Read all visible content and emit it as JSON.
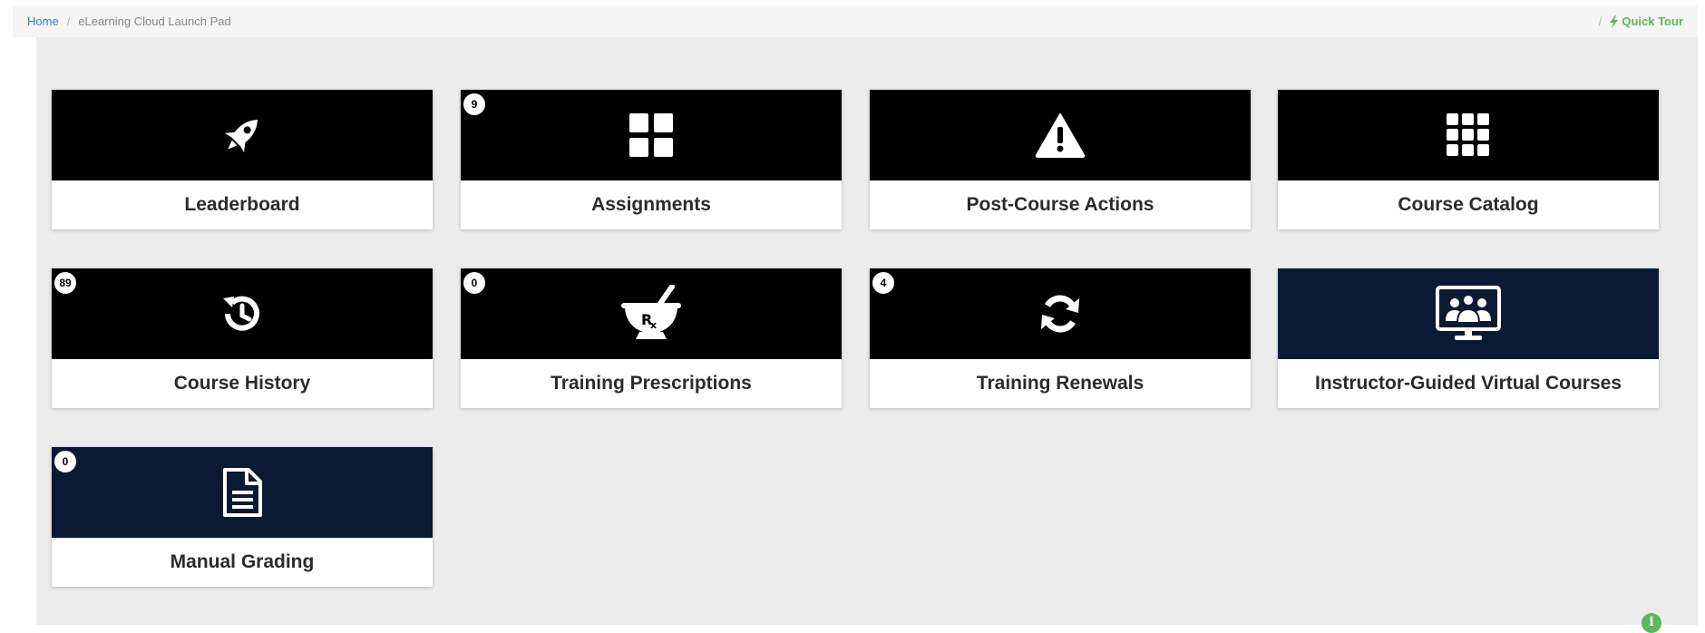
{
  "breadcrumb": {
    "home": "Home",
    "separator": "/",
    "current": "eLearning Cloud Launch Pad"
  },
  "quick_tour": {
    "separator": "/",
    "label": "Quick Tour",
    "icon": "bolt-icon"
  },
  "tiles": [
    {
      "label": "Leaderboard",
      "icon": "rocket-icon",
      "badge": null,
      "theme": "black"
    },
    {
      "label": "Assignments",
      "icon": "th-large-icon",
      "badge": "9",
      "theme": "black"
    },
    {
      "label": "Post-Course Actions",
      "icon": "warning-icon",
      "badge": null,
      "theme": "black"
    },
    {
      "label": "Course Catalog",
      "icon": "grid-icon",
      "badge": null,
      "theme": "black"
    },
    {
      "label": "Course History",
      "icon": "history-icon",
      "badge": "89",
      "theme": "black"
    },
    {
      "label": "Training Prescriptions",
      "icon": "mortar-pestle-rx-icon",
      "badge": "0",
      "theme": "black"
    },
    {
      "label": "Training Renewals",
      "icon": "refresh-icon",
      "badge": "4",
      "theme": "black"
    },
    {
      "label": "Instructor-Guided Virtual Courses",
      "icon": "virtual-class-icon",
      "badge": null,
      "theme": "navy"
    },
    {
      "label": "Manual Grading",
      "icon": "document-icon",
      "badge": "0",
      "theme": "navy"
    }
  ],
  "colors": {
    "tile_black": "#000000",
    "tile_navy": "#0b1a33",
    "link_blue": "#3f7cc4",
    "accent_green": "#5cb85c",
    "panel_bg": "#ececec"
  },
  "info": {
    "icon": "info-icon",
    "glyph": "i"
  }
}
